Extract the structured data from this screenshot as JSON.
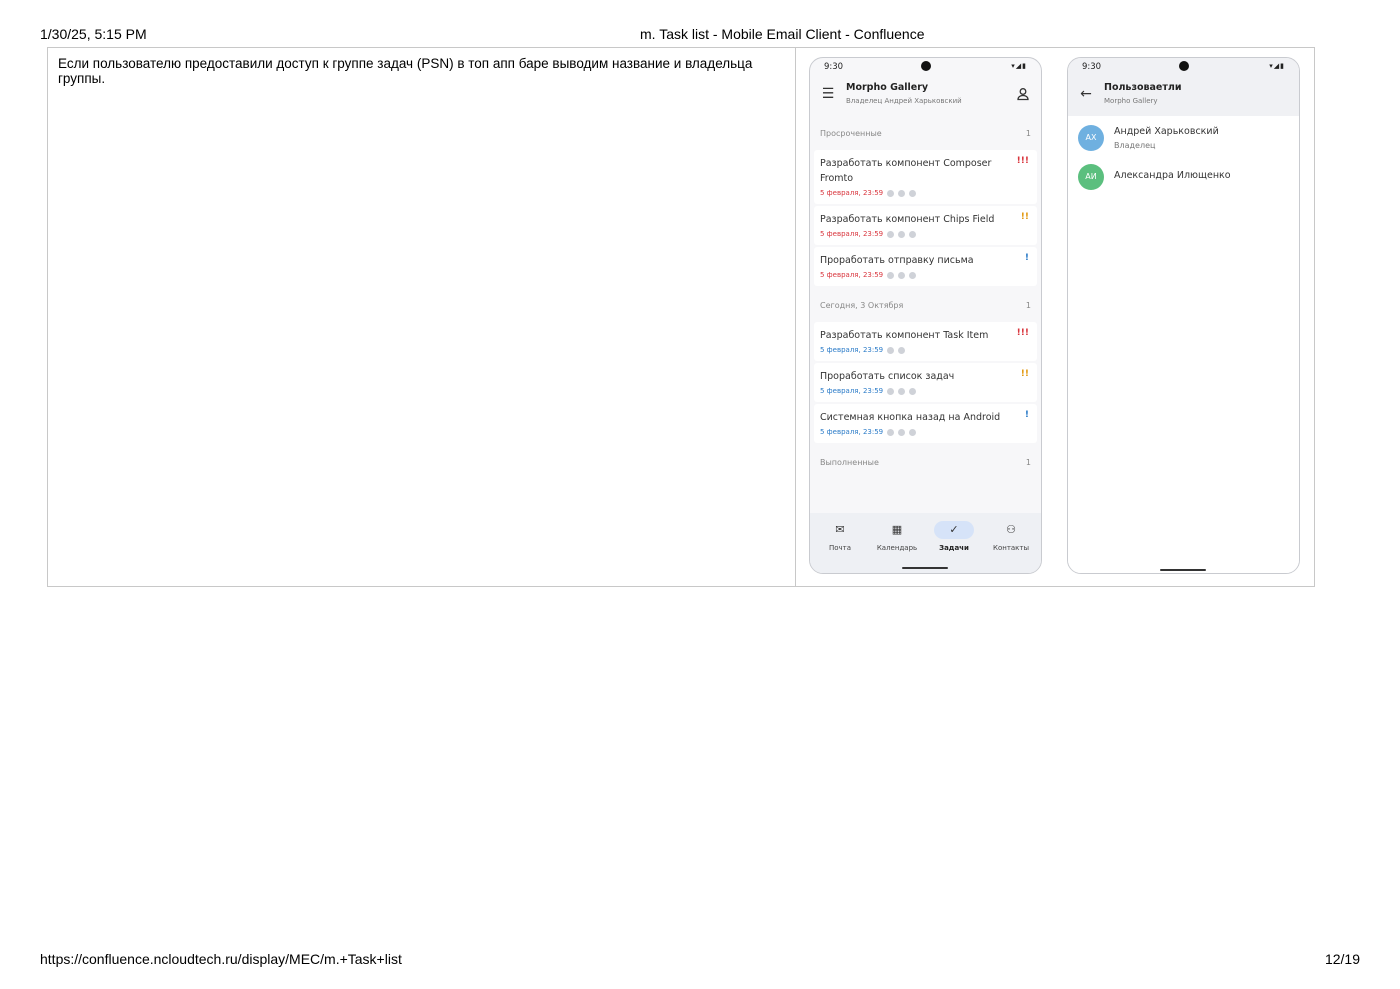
{
  "print_header": {
    "datetime": "1/30/25, 5:15 PM",
    "page_title": "m. Task list - Mobile Email Client - Confluence"
  },
  "print_footer": {
    "url": "https://confluence.ncloudtech.ru/display/MEC/m.+Task+list",
    "page_number": "12/19"
  },
  "description": "Если пользователю предоставили доступ к группе задач (PSN) в топ апп баре выводим название и владельца группы.",
  "phone_tasks": {
    "status_time": "9:30",
    "appbar": {
      "title": "Morpho Gallery",
      "subtitle": "Владелец Андрей Харьковский",
      "leading_icon": "menu-icon",
      "trailing_icon": "person-icon"
    },
    "sections": [
      {
        "title": "Просроченные",
        "count": "1",
        "tasks": [
          {
            "title": "Разработать компонент Composer Fromto",
            "date": "5 февраля, 23:59",
            "priority": "!!!",
            "priority_color": "#d9363e",
            "date_color": "red"
          },
          {
            "title": "Разработать компонент Chips Field",
            "date": "5 февраля, 23:59",
            "priority": "!!",
            "priority_color": "#e39a12",
            "date_color": "red"
          },
          {
            "title": "Проработать отправку письма",
            "date": "5 февраля, 23:59",
            "priority": "!",
            "priority_color": "#2b7bc8",
            "date_color": "red"
          }
        ]
      },
      {
        "title": "Сегодня, 3 Октября",
        "count": "1",
        "tasks": [
          {
            "title": "Разработать компонент Task Item",
            "date": "5 февраля, 23:59",
            "priority": "!!!",
            "priority_color": "#d9363e",
            "date_color": "blue"
          },
          {
            "title": "Проработать список задач",
            "date": "5 февраля, 23:59",
            "priority": "!!",
            "priority_color": "#e39a12",
            "date_color": "blue"
          },
          {
            "title": "Системная кнопка назад на Android",
            "date": "5 февраля, 23:59",
            "priority": "!",
            "priority_color": "#2b7bc8",
            "date_color": "blue"
          }
        ]
      },
      {
        "title": "Выполненные",
        "count": "1",
        "tasks": []
      }
    ],
    "bottom_nav": [
      {
        "label": "Почта",
        "icon": "mail-icon",
        "active": false
      },
      {
        "label": "Календарь",
        "icon": "calendar-icon",
        "active": false
      },
      {
        "label": "Задачи",
        "icon": "check-circle-icon",
        "active": true
      },
      {
        "label": "Контакты",
        "icon": "contacts-icon",
        "active": false
      }
    ]
  },
  "phone_users": {
    "status_time": "9:30",
    "appbar": {
      "title": "Пользоваетли",
      "subtitle": "Morpho Gallery",
      "leading_icon": "back-arrow-icon"
    },
    "users": [
      {
        "initials": "АХ",
        "name": "Андрей Харьковский",
        "role": "Владелец",
        "avatar_color": "#6fb0e0"
      },
      {
        "initials": "АИ",
        "name": "Александра Илющенко",
        "role": "",
        "avatar_color": "#5bbf7e"
      }
    ]
  },
  "colors": {
    "overdue_date": "#d9363e",
    "today_date": "#2b7bc8",
    "nav_active_pill": "#d6e3f8"
  }
}
